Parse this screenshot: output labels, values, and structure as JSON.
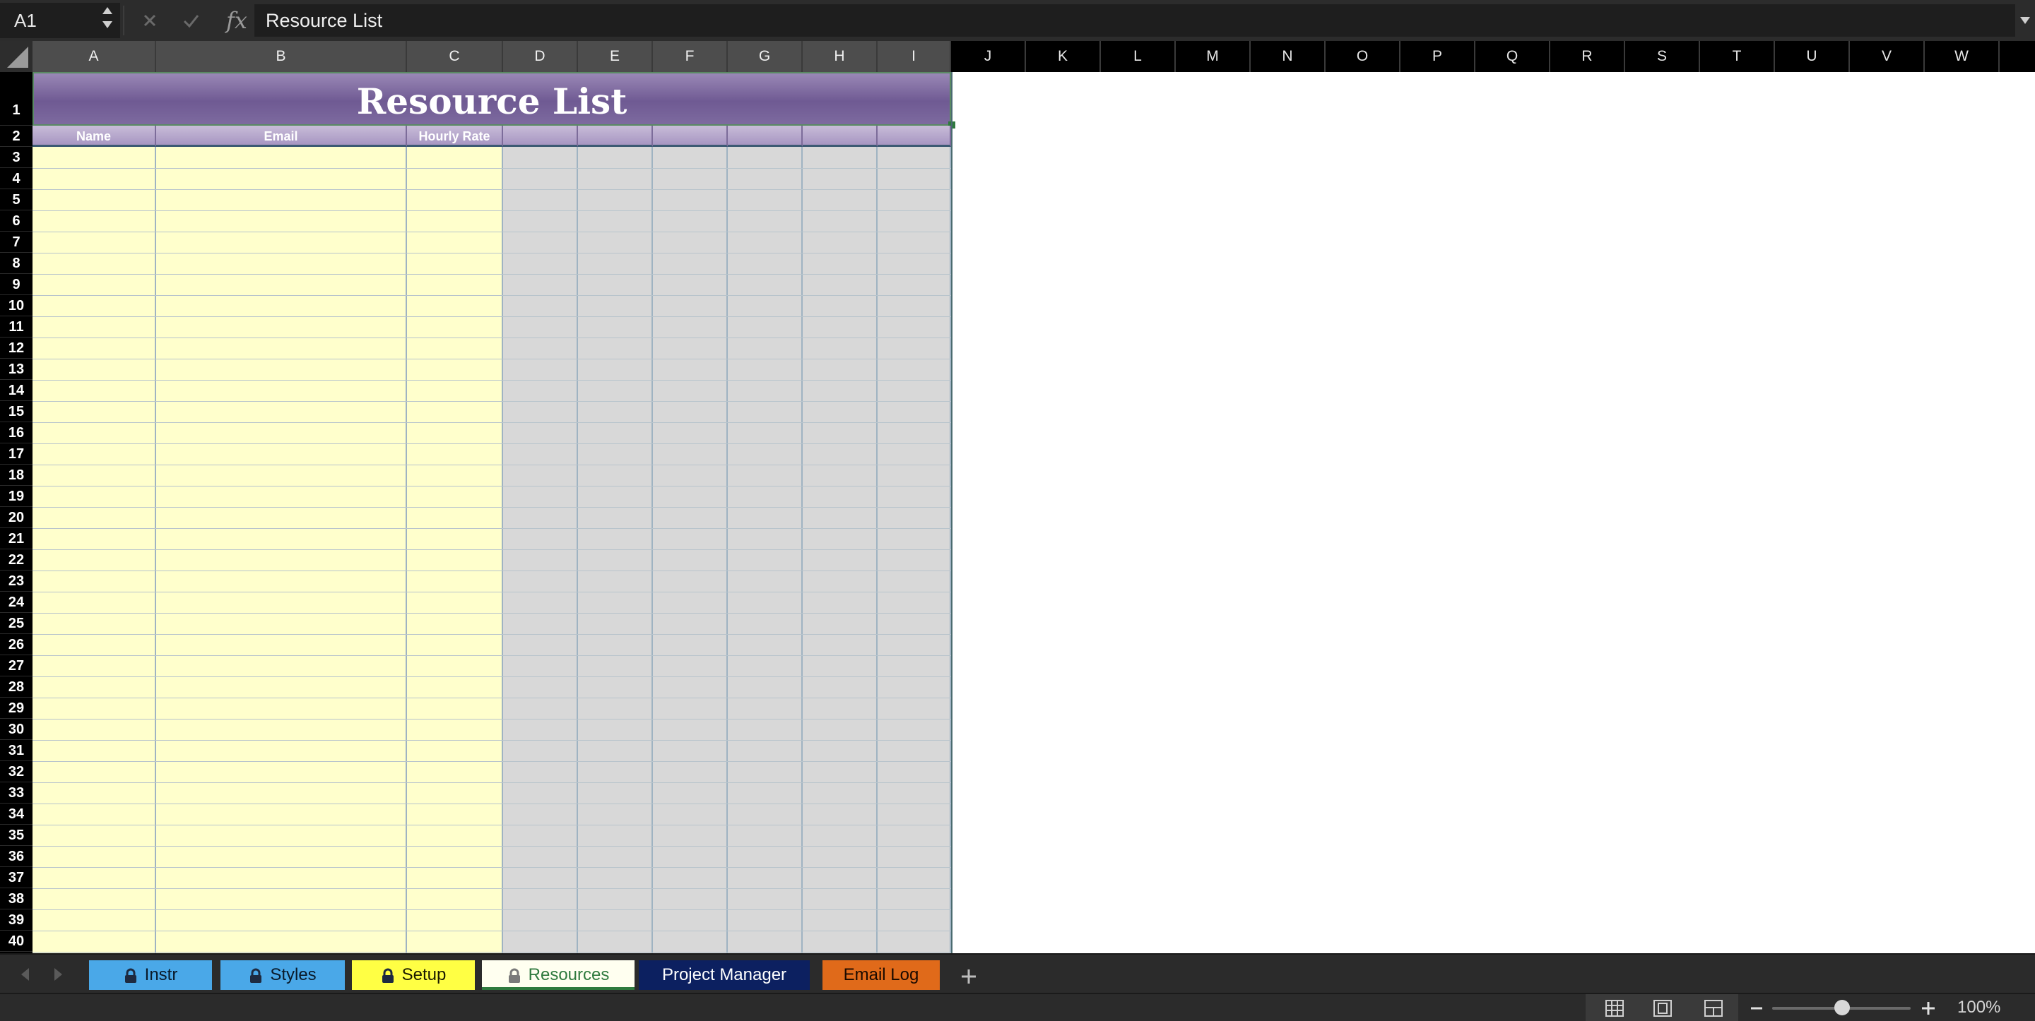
{
  "formula_bar": {
    "name_box": "A1",
    "formula": "Resource List",
    "fx_label": "fx"
  },
  "columns": [
    "A",
    "B",
    "C",
    "D",
    "E",
    "F",
    "G",
    "H",
    "I",
    "J",
    "K",
    "L",
    "M",
    "N",
    "O",
    "P",
    "Q",
    "R",
    "S",
    "T",
    "U",
    "V",
    "W"
  ],
  "rows_visible": [
    1,
    2,
    3,
    4,
    5,
    6,
    7,
    8,
    9,
    10,
    11,
    12,
    13,
    14,
    15,
    16,
    17,
    18,
    19,
    20,
    21,
    22,
    23,
    24,
    25,
    26,
    27,
    28,
    29,
    30,
    31,
    32,
    33,
    34,
    35,
    36,
    37,
    38,
    39,
    40
  ],
  "sheet": {
    "title": "Resource List",
    "headers": [
      "Name",
      "Email",
      "Hourly Rate"
    ]
  },
  "tabs": [
    {
      "label": "Instr",
      "locked": true,
      "active": false,
      "bg": "#4aa8e8",
      "color": "#0a1a2a"
    },
    {
      "label": "Styles",
      "locked": true,
      "active": false,
      "bg": "#4aa8e8",
      "color": "#0a1a2a"
    },
    {
      "label": "Setup",
      "locked": true,
      "active": false,
      "bg": "#ffff44",
      "color": "#1a1a00"
    },
    {
      "label": "Resources",
      "locked": true,
      "active": true,
      "bg": "#fffff0",
      "color": "#2f7a3e"
    },
    {
      "label": "Project Manager",
      "locked": false,
      "active": false,
      "bg": "#0c2060",
      "color": "#ffffff"
    },
    {
      "label": "Email Log",
      "locked": false,
      "active": false,
      "bg": "#e06a1a",
      "color": "#1a0a00"
    }
  ],
  "status": {
    "zoom": "100%",
    "views": [
      "normal-view-icon",
      "page-layout-icon",
      "page-break-preview-icon"
    ]
  },
  "colors": {
    "title_band": "#6f5a93",
    "input_fill": "#ffffcc",
    "locked_fill": "#d8d8d8"
  }
}
